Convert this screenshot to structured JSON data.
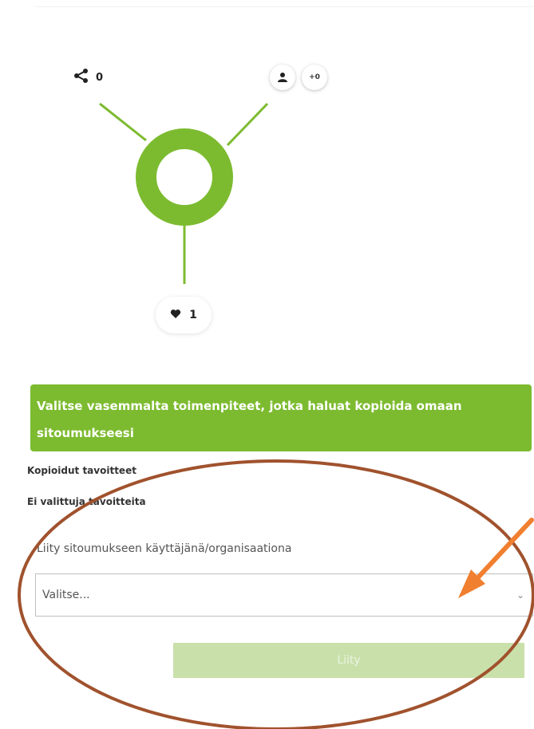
{
  "graph": {
    "shares_count": "0",
    "people_extra": "+0",
    "likes_count": "1"
  },
  "banner": {
    "text": "Valitse vasemmalta toimenpiteet, jotka haluat kopioida omaan sitoumukseesi"
  },
  "copied_goals": {
    "heading": "Kopioidut tavoitteet",
    "empty_text": "Ei valittuja tavoitteita"
  },
  "join": {
    "label": "Liity sitoumukseen käyttäjänä/organisaationa",
    "select_value": "Valitse...",
    "button_label": "Liity"
  },
  "colors": {
    "accent": "#7cbb2f",
    "button_disabled": "#c9e0ab",
    "annotation": "#a0522d",
    "arrow": "#f07f30"
  }
}
